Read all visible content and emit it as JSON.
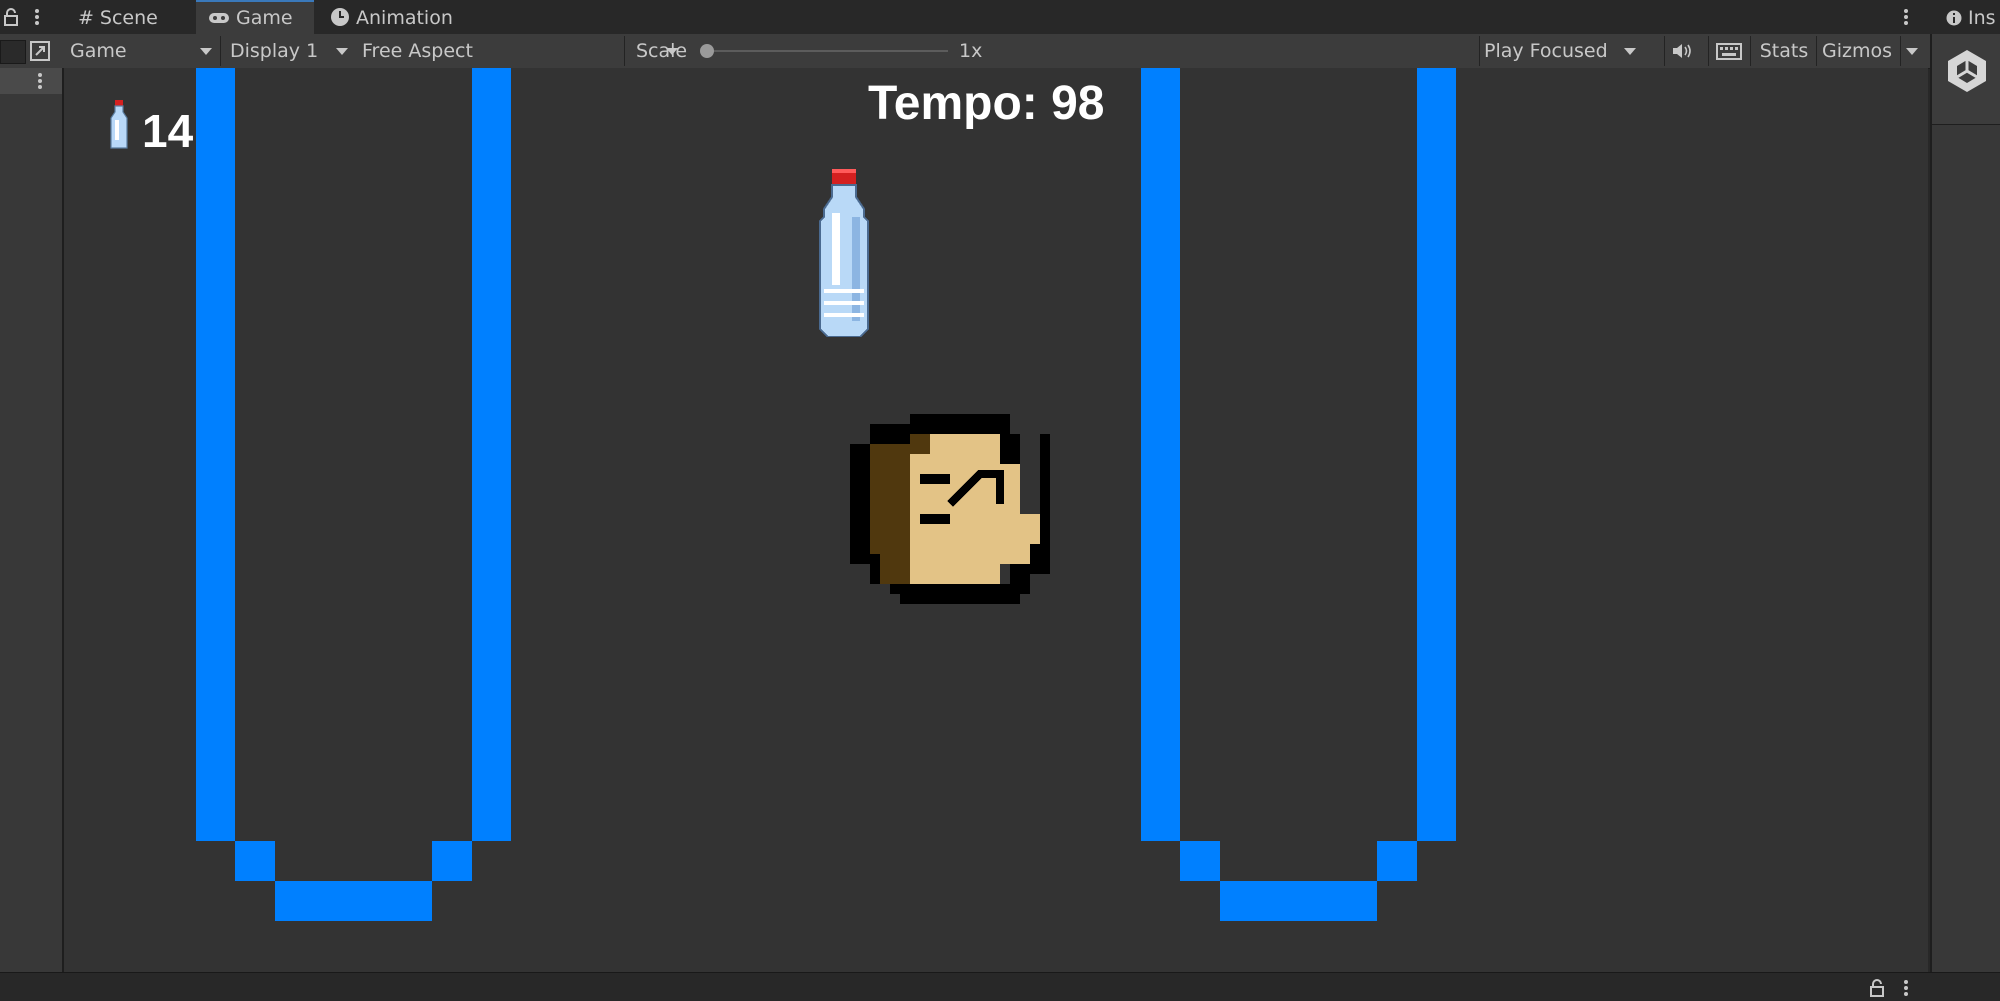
{
  "tabs": [
    {
      "label": "Scene",
      "icon": "grid-icon"
    },
    {
      "label": "Game",
      "icon": "gamepad-icon",
      "active": true
    },
    {
      "label": "Animation",
      "icon": "clock-icon"
    }
  ],
  "toolbar": {
    "view_select": "Game",
    "display_select": "Display 1",
    "aspect_select": "Free Aspect",
    "scale_label": "Scale",
    "scale_value": "1x",
    "scale_fraction": 0,
    "play_mode": "Play Focused",
    "stats": "Stats",
    "gizmos": "Gizmos"
  },
  "inspector": {
    "tab_label": "Ins"
  },
  "game": {
    "bottle_count": "14",
    "timer_text": "Tempo: 98"
  },
  "colors": {
    "pipe": "#0080ff",
    "game_background": "#333333",
    "accent_tab": "#3a79bb"
  }
}
